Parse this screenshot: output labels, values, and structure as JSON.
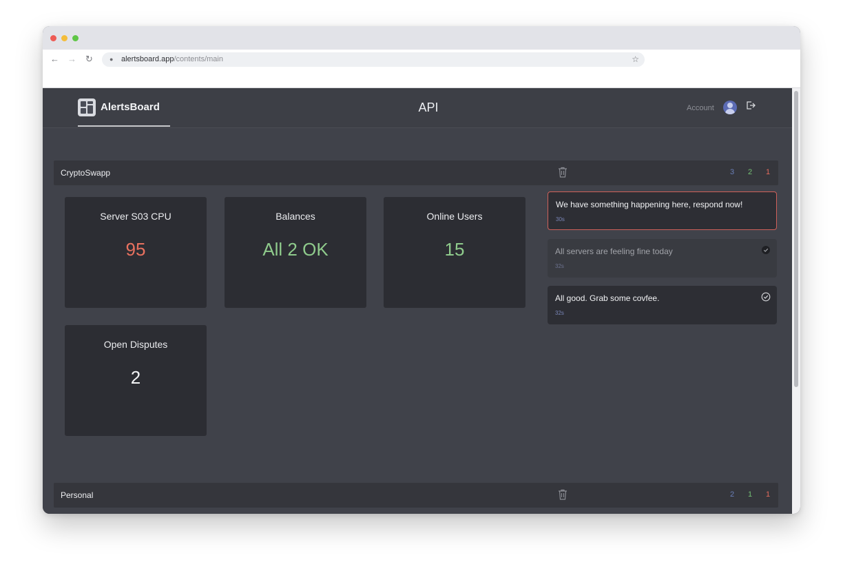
{
  "browser": {
    "url_host": "alertsboard.app",
    "url_path": "/contents/main"
  },
  "app": {
    "brand": "AlertsBoard",
    "page_title": "API",
    "account_label": "Account"
  },
  "groups": [
    {
      "name": "CryptoSwapp",
      "counts": {
        "blue": "3",
        "green": "2",
        "red": "1"
      },
      "metrics": [
        {
          "title": "Server S03 CPU",
          "value": "95",
          "status_color": "#e8715f"
        },
        {
          "title": "Balances",
          "value": "All 2 OK",
          "status_color": "#8fcb8c"
        },
        {
          "title": "Online Users",
          "value": "15",
          "status_color": "#8fcb8c"
        },
        {
          "title": "Open Disputes",
          "value": "2",
          "status_color": "#f3f4f6"
        }
      ],
      "alerts": [
        {
          "text": "We have something happening here, respond now!",
          "time": "30s",
          "state": "critical"
        },
        {
          "text": "All servers are feeling fine today",
          "time": "32s",
          "state": "acknowledged"
        },
        {
          "text": "All good. Grab some covfee.",
          "time": "32s",
          "state": "resolved"
        }
      ]
    },
    {
      "name": "Personal",
      "counts": {
        "blue": "2",
        "green": "1",
        "red": "1"
      }
    }
  ],
  "colors": {
    "background": "#40424a",
    "card": "#2c2d33",
    "critical": "#d0615a",
    "ok": "#8fcb8c",
    "info": "#6a7fb8"
  },
  "icons": [
    "back-arrow-icon",
    "forward-arrow-icon",
    "reload-icon",
    "lock-icon",
    "star-icon",
    "dashboard-logo-icon",
    "user-avatar-icon",
    "logout-icon",
    "trash-icon",
    "check-circle-icon"
  ]
}
